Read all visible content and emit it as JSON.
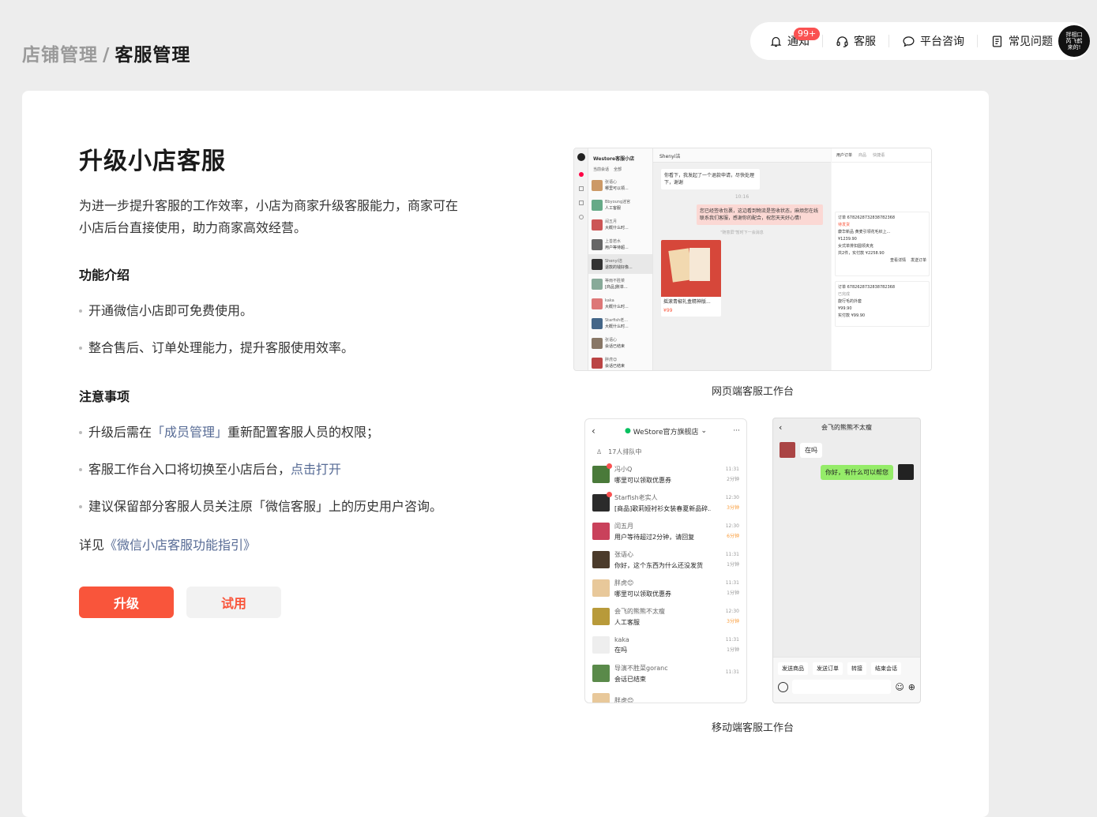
{
  "topnav": {
    "notice_label": "通知",
    "notice_badge": "99+",
    "service_label": "客服",
    "consult_label": "平台咨询",
    "faq_label": "常见问题",
    "avatar_text": "拌相口 芮飞鹤 来的!"
  },
  "breadcrumb": {
    "parent": "店铺管理",
    "sep": "/",
    "current": "客服管理"
  },
  "main": {
    "title": "升级小店客服",
    "intro": "为进一步提升客服的工作效率，小店为商家升级客服能力，商家可在小店后台直接使用，助力商家高效经营。",
    "features_heading": "功能介绍",
    "features": [
      "开通微信小店即可免费使用。",
      "整合售后、订单处理能力，提升客服使用效率。"
    ],
    "notes_heading": "注意事项",
    "note1_pre": "升级后需在",
    "note1_link": "「成员管理」",
    "note1_post": "重新配置客服人员的权限；",
    "note2_pre": "客服工作台入口将切换至小店后台，",
    "note2_link": "点击打开",
    "note3": "建议保留部分客服人员关注原「微信客服」上的历史用户咨询。",
    "see_pre": "详见",
    "see_link": "《微信小店客服功能指引》",
    "upgrade_button": "升级",
    "trial_button": "试用"
  },
  "web_preview": {
    "caption": "网页端客服工作台",
    "app_name": "Westore客服小店",
    "tabs": [
      "当前会话",
      "全部"
    ],
    "contact": "Shenyi洁",
    "right_tabs": [
      "用户订单",
      "商品",
      "快捷语"
    ],
    "list": [
      {
        "name": "张语心",
        "msg": "哪里可以领...",
        "color": "#c96"
      },
      {
        "name": "Bbyoung迷官",
        "msg": "人工客服",
        "color": "#6a8"
      },
      {
        "name": "闰五月",
        "msg": "大概什么时...",
        "color": "#c55"
      },
      {
        "name": "上善若水",
        "msg": "用户等待超...",
        "color": "#666"
      },
      {
        "name": "Shenyi洁",
        "msg": "退款的钱好像...",
        "color": "#333"
      },
      {
        "name": "等雨不胜菜",
        "msg": "[商品]账单...",
        "color": "#8a9"
      },
      {
        "name": "kaka",
        "msg": "大概什么时...",
        "color": "#d77"
      },
      {
        "name": "Starfish老...",
        "msg": "大概什么时...",
        "color": "#468"
      },
      {
        "name": "张语心",
        "msg": "会话已结束",
        "color": "#876"
      },
      {
        "name": "胖虎😊",
        "msg": "会话已结束",
        "color": "#b44"
      }
    ],
    "chat_msg1": "你看下，我发起了一个退款申请，尽快处理下，谢谢",
    "chat_time": "10:16",
    "chat_msg2": "您已经签收包裹，这边看到物流是签收状态，麻烦您在线联系我们客服，感谢你的配合，祝您天天好心情!",
    "chat_note": "\"随意屏\"暂时下一会消息",
    "product_name": "摇滚青椒礼盒精神版...",
    "product_price": "¥99",
    "orders": [
      {
        "id": "订单 6782628732838782368",
        "status": "待发货",
        "item1": "康华新品 黄麦引领花毛织上...",
        "price1": "¥1239.90",
        "item2": "女式单排扣圆领夹克",
        "price2": "¥929.00",
        "total": "共2件，实付款 ¥2258.90"
      },
      {
        "id": "订单 6782628732838782368",
        "status": "已完成",
        "item1": "旋行毛的外套",
        "price1": "¥99.90",
        "total": "实付款 ¥99.90"
      }
    ],
    "order_buttons": [
      "查看详情",
      "发送订单"
    ]
  },
  "mobile_list": {
    "title": "WeStore官方旗舰店",
    "queue": "17人排队中",
    "rows": [
      {
        "name": "冯小Q",
        "msg": "哪里可以领取优惠券",
        "time": "11:31",
        "wait": "2分钟",
        "color": "#4a7a3a",
        "dot": true
      },
      {
        "name": "Starfish老实人",
        "msg": "[商品]歌莉娅衬衫女装春夏新品碎...",
        "time": "12:30",
        "wait": "3分钟",
        "color": "#2b2b2b",
        "dot": true
      },
      {
        "name": "闰五月",
        "msg": "用户等待超过2分钟，请回复",
        "time": "12:30",
        "wait": "6分钟",
        "color": "#c9415b",
        "dot": false
      },
      {
        "name": "张语心",
        "msg": "你好，这个东西为什么还没发货",
        "time": "11:31",
        "wait": "1分钟",
        "color": "#4b3b2b",
        "dot": false
      },
      {
        "name": "胖虎😊",
        "msg": "哪里可以领取优惠券",
        "time": "11:31",
        "wait": "1分钟",
        "color": "#e8c89a",
        "dot": false
      },
      {
        "name": "会飞的熊熊不太瘦",
        "msg": "人工客服",
        "time": "12:30",
        "wait": "3分钟",
        "color": "#b89a3a",
        "dot": false
      },
      {
        "name": "kaka",
        "msg": "在吗",
        "time": "11:31",
        "wait": "1分钟",
        "color": "#eeeeee",
        "dot": false
      },
      {
        "name": "导演不胜菜goranc",
        "msg": "会话已结束",
        "time": "11:31",
        "wait": "",
        "color": "#5a8a4a",
        "dot": false
      },
      {
        "name": "胖虎😊",
        "msg": "",
        "time": "",
        "wait": "",
        "color": "#e8c89a",
        "dot": false
      }
    ]
  },
  "mobile_chat": {
    "title": "会飞的熊熊不太瘦",
    "msg_in": "在吗",
    "msg_out": "你好，有什么可以帮您",
    "actions": [
      "发送商品",
      "发送订单",
      "转接",
      "结束会话"
    ]
  },
  "mobile_caption": "移动端客服工作台"
}
